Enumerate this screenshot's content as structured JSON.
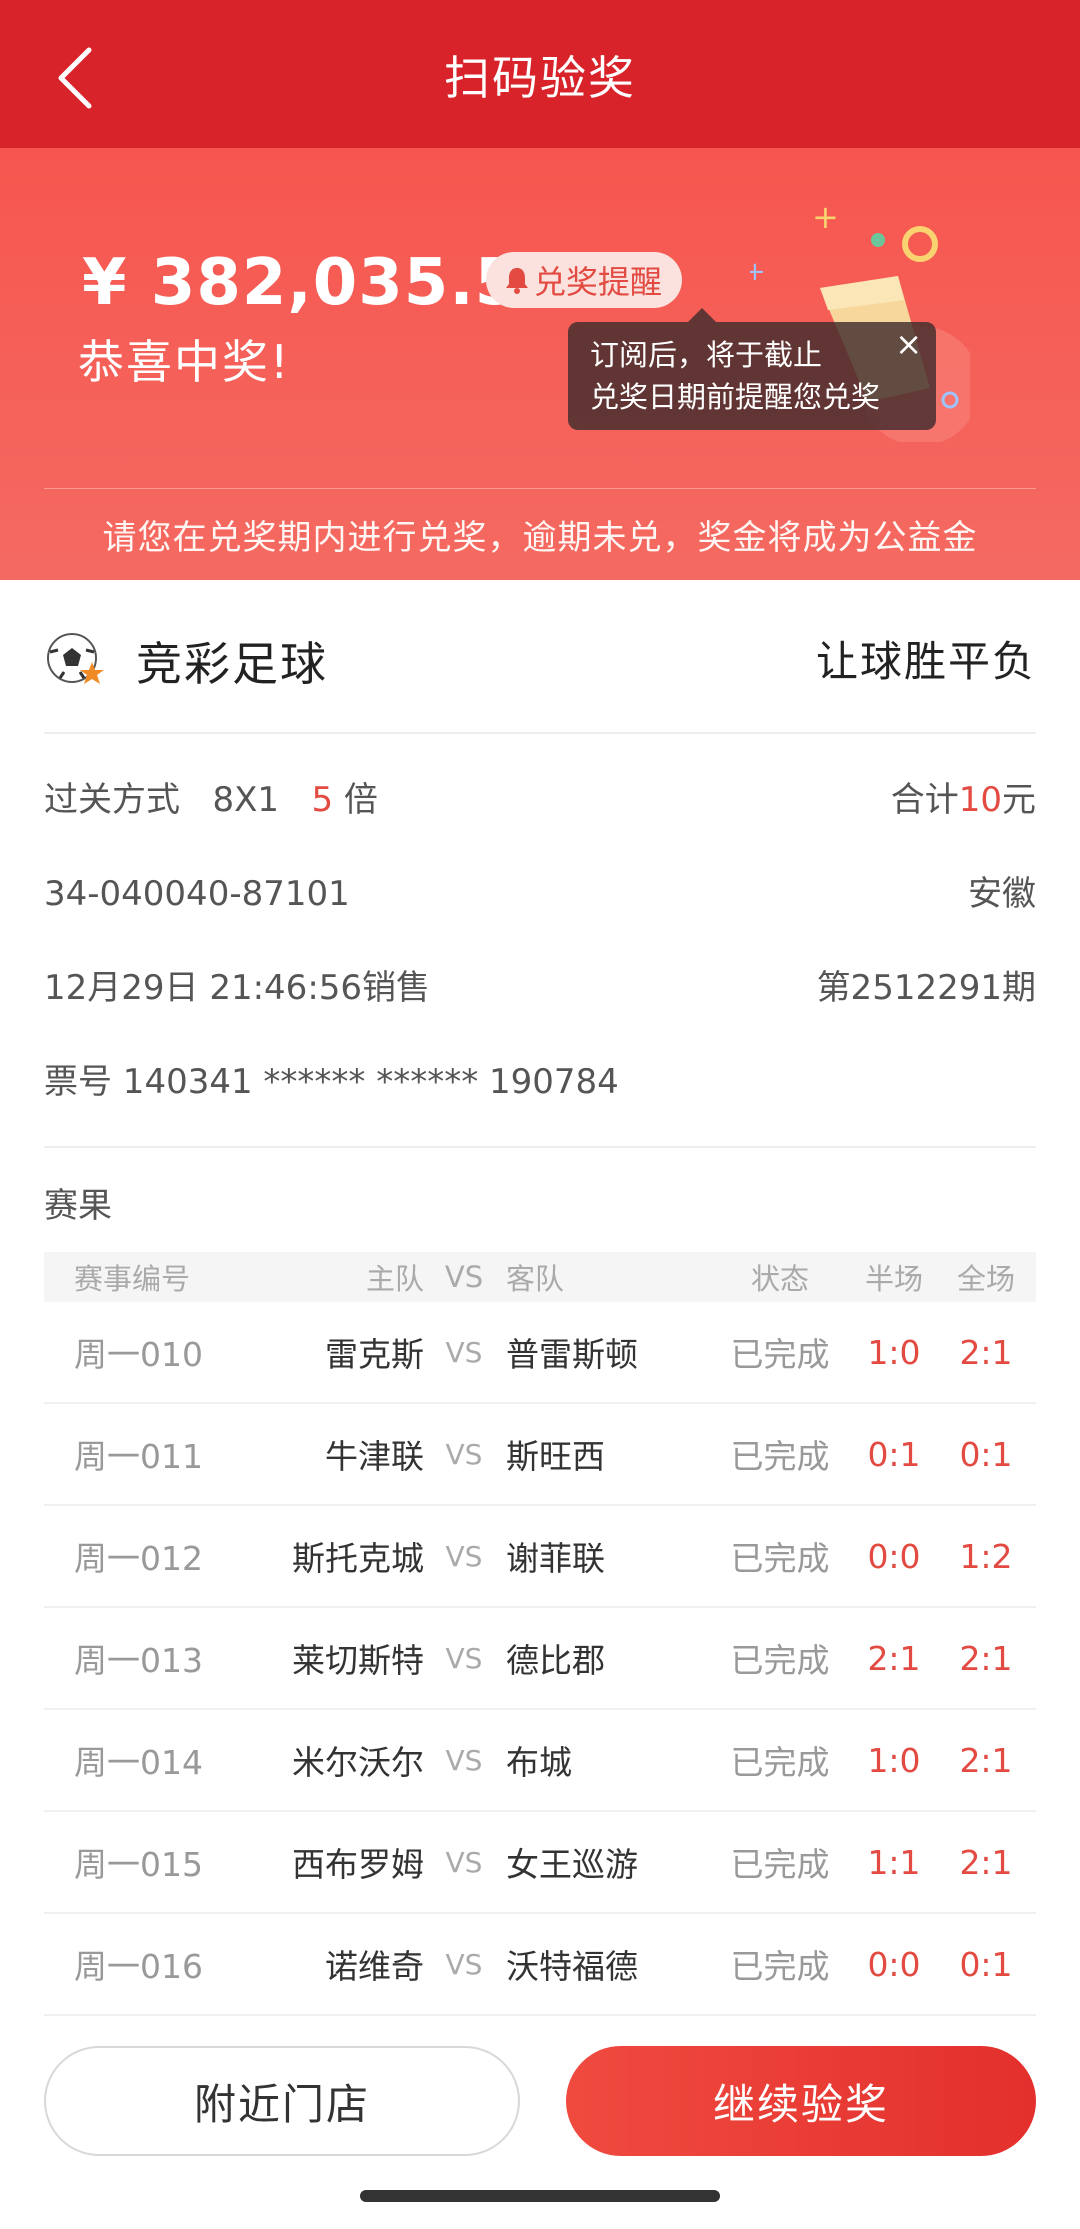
{
  "nav": {
    "title": "扫码验奖"
  },
  "banner": {
    "amount": "¥ 382,035.50",
    "reminder_label": "兑奖提醒",
    "congrats": "恭喜中奖!",
    "tooltip_line1": "订阅后，将于截止",
    "tooltip_line2": "兑奖日期前提醒您兑奖",
    "tooltip_close": "×",
    "notice": "请您在兑奖期内进行兑奖，逾期未兑，奖金将成为公益金"
  },
  "ticket": {
    "lottery_name": "竞彩足球",
    "play_type": "让球胜平负",
    "pass_label": "过关方式",
    "pass_value": "8X1",
    "multiple_value": "5",
    "multiple_unit": "倍",
    "total_label": "合计",
    "total_value": "10",
    "total_unit": "元",
    "serial": "34-040040-87101",
    "province": "安徽",
    "sale_time": "12月29日 21:46:56销售",
    "issue": "第2512291期",
    "ticket_no": "票号 140341 ****** ****** 190784"
  },
  "results": {
    "title": "赛果",
    "headers": {
      "id": "赛事编号",
      "home": "主队",
      "vs": "VS",
      "away": "客队",
      "status": "状态",
      "half": "半场",
      "full": "全场"
    },
    "rows": [
      {
        "id": "周一010",
        "home": "雷克斯",
        "vs": "VS",
        "away": "普雷斯顿",
        "status": "已完成",
        "half": "1:0",
        "full": "2:1"
      },
      {
        "id": "周一011",
        "home": "牛津联",
        "vs": "VS",
        "away": "斯旺西",
        "status": "已完成",
        "half": "0:1",
        "full": "0:1"
      },
      {
        "id": "周一012",
        "home": "斯托克城",
        "vs": "VS",
        "away": "谢菲联",
        "status": "已完成",
        "half": "0:0",
        "full": "1:2"
      },
      {
        "id": "周一013",
        "home": "莱切斯特",
        "vs": "VS",
        "away": "德比郡",
        "status": "已完成",
        "half": "2:1",
        "full": "2:1"
      },
      {
        "id": "周一014",
        "home": "米尔沃尔",
        "vs": "VS",
        "away": "布城",
        "status": "已完成",
        "half": "1:0",
        "full": "2:1"
      },
      {
        "id": "周一015",
        "home": "西布罗姆",
        "vs": "VS",
        "away": "女王巡游",
        "status": "已完成",
        "half": "1:1",
        "full": "2:1"
      },
      {
        "id": "周一016",
        "home": "诺维奇",
        "vs": "VS",
        "away": "沃特福德",
        "status": "已完成",
        "half": "0:0",
        "full": "0:1"
      }
    ]
  },
  "actions": {
    "nearby_store": "附近门店",
    "continue_check": "继续验奖"
  },
  "colors": {
    "nav_red": "#d9232b",
    "banner_red": "#f6564f",
    "accent_red": "#e24a42"
  },
  "icons": {
    "back": "chevron-left-icon",
    "bell": "bell-icon",
    "ball": "soccer-ball-icon"
  }
}
